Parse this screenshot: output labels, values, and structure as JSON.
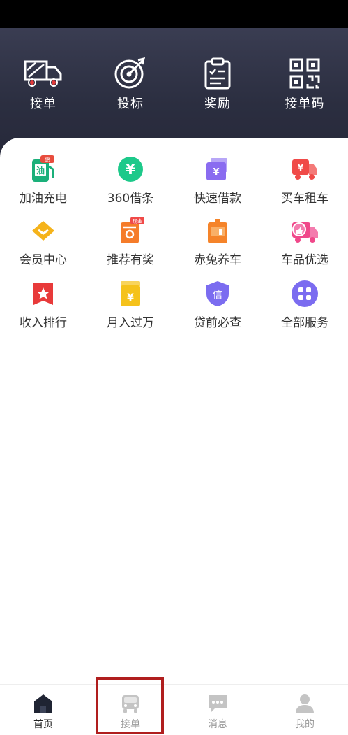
{
  "header": {
    "actions": [
      {
        "label": "接单",
        "icon": "truck-icon"
      },
      {
        "label": "投标",
        "icon": "target-icon"
      },
      {
        "label": "奖励",
        "icon": "clipboard-icon"
      },
      {
        "label": "接单码",
        "icon": "qr-code-icon"
      }
    ]
  },
  "services": [
    {
      "label": "加油充电",
      "icon": "fuel-icon",
      "badge": "惠",
      "color": "#1bb07a"
    },
    {
      "label": "360借条",
      "icon": "yuan-coin-icon",
      "color": "#1dc98a"
    },
    {
      "label": "快速借款",
      "icon": "wallet-icon",
      "color": "#8a6cf0"
    },
    {
      "label": "买车租车",
      "icon": "car-yuan-icon",
      "color": "#f04a48"
    },
    {
      "label": "会员中心",
      "icon": "diamond-icon",
      "color": "#f5b31b"
    },
    {
      "label": "推荐有奖",
      "icon": "gift-icon",
      "badge": "现金",
      "color": "#f57c2a"
    },
    {
      "label": "赤兔养车",
      "icon": "toolbox-icon",
      "color": "#f5842a"
    },
    {
      "label": "车品优选",
      "icon": "thumb-truck-icon",
      "color": "#f0488a"
    },
    {
      "label": "收入排行",
      "icon": "ranking-icon",
      "color": "#e83a3a"
    },
    {
      "label": "月入过万",
      "icon": "yuan-box-icon",
      "color": "#f5c21b"
    },
    {
      "label": "贷前必查",
      "icon": "credit-shield-icon",
      "glyph": "信",
      "color": "#7b6cf0"
    },
    {
      "label": "全部服务",
      "icon": "grid-icon",
      "color": "#7b6cf0"
    }
  ],
  "tabbar": {
    "items": [
      {
        "label": "首页",
        "icon": "home-icon"
      },
      {
        "label": "接单",
        "icon": "truck-front-icon"
      },
      {
        "label": "消息",
        "icon": "chat-icon"
      },
      {
        "label": "我的",
        "icon": "person-icon"
      }
    ]
  }
}
